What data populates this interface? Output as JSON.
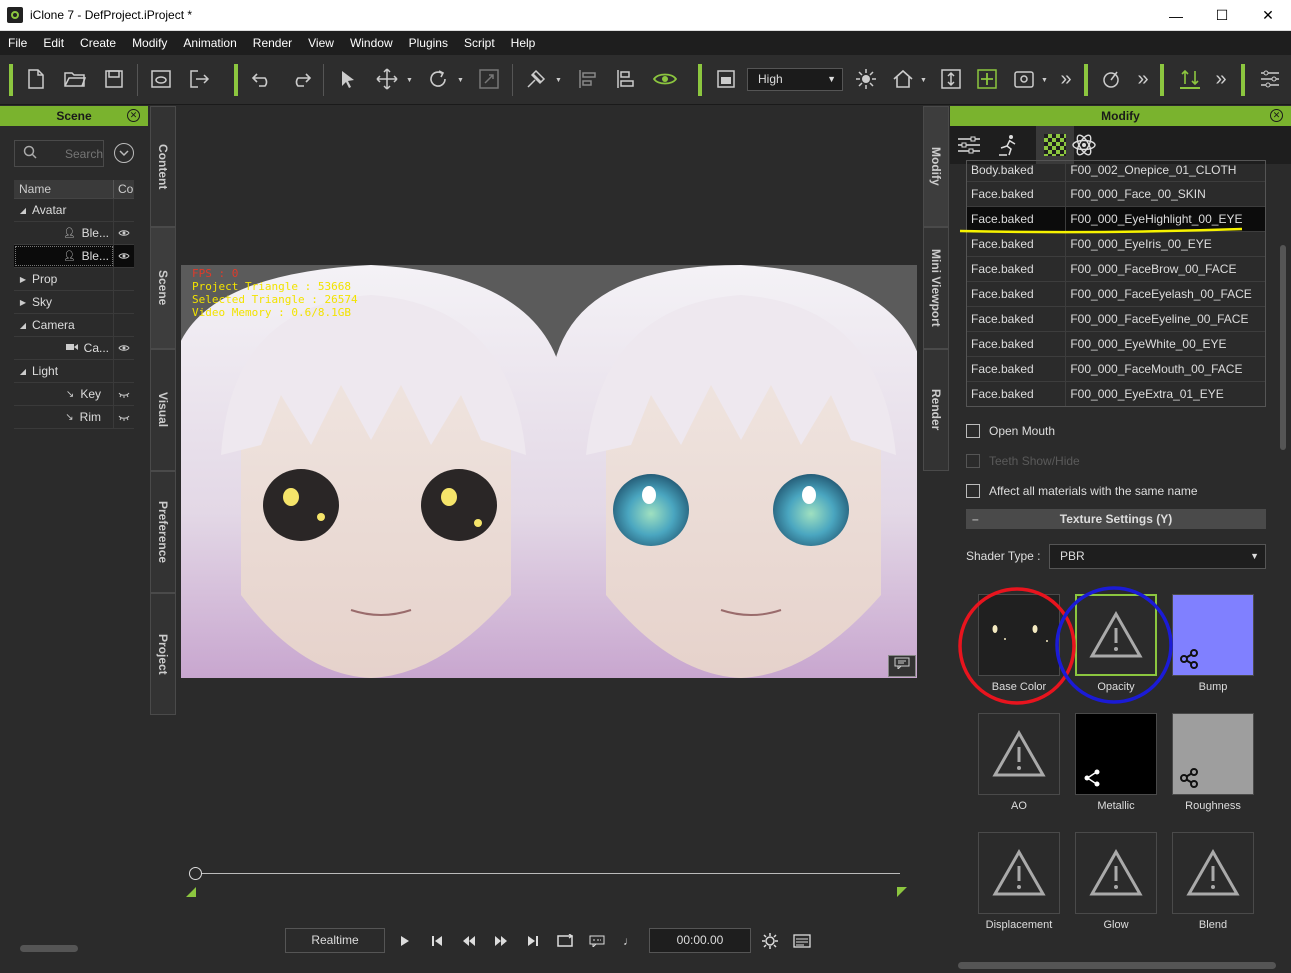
{
  "window": {
    "title": "iClone 7 - DefProject.iProject *",
    "controls": [
      "—",
      "☐",
      "✕"
    ]
  },
  "menu": [
    "File",
    "Edit",
    "Create",
    "Modify",
    "Animation",
    "Render",
    "View",
    "Window",
    "Plugins",
    "Script",
    "Help"
  ],
  "toolbar": {
    "quality_value": "High",
    "overflow_glyph": "»"
  },
  "scene_panel": {
    "title": "Scene",
    "search_placeholder": "Search",
    "columns": [
      "Name",
      "Co"
    ],
    "rows": [
      {
        "label": "Avatar",
        "type": "group",
        "expanded": true
      },
      {
        "label": "Ble...",
        "type": "child",
        "icon": "person-icon",
        "visibility": "eye-icon"
      },
      {
        "label": "Ble...",
        "type": "child",
        "icon": "person-icon",
        "visibility": "eye-icon",
        "selected": true
      },
      {
        "label": "Prop",
        "type": "group",
        "expanded": false
      },
      {
        "label": "Sky",
        "type": "group",
        "expanded": false
      },
      {
        "label": "Camera",
        "type": "group",
        "expanded": true
      },
      {
        "label": "Ca...",
        "type": "child",
        "icon": "camera-icon",
        "visibility": "eye-icon"
      },
      {
        "label": "Light",
        "type": "group",
        "expanded": true
      },
      {
        "label": "Key",
        "type": "child",
        "icon": "light-icon",
        "visibility": "eye-closed-icon"
      },
      {
        "label": "Rim",
        "type": "child",
        "icon": "light-icon",
        "visibility": "eye-closed-icon"
      }
    ]
  },
  "left_tabs": [
    "Content",
    "Scene",
    "Visual",
    "Preference",
    "Project"
  ],
  "right_tabs": [
    "Modify",
    "Mini Viewport",
    "Render"
  ],
  "viewport": {
    "stats": {
      "fps": "FPS : 0",
      "project_triangle": "Project Triangle : 53668",
      "selected_triangle": "Selected Triangle : 26574",
      "video_memory": "Video Memory : 0.6/8.1GB"
    }
  },
  "playback": {
    "mode": "Realtime",
    "timecode": "00:00.00"
  },
  "modify_panel": {
    "title": "Modify",
    "materials": [
      {
        "object": "Body.baked",
        "material": "F00_002_Onepice_01_CLOTH"
      },
      {
        "object": "Face.baked",
        "material": "F00_000_Face_00_SKIN"
      },
      {
        "object": "Face.baked",
        "material": "F00_000_EyeHighlight_00_EYE",
        "selected": true
      },
      {
        "object": "Face.baked",
        "material": "F00_000_EyeIris_00_EYE"
      },
      {
        "object": "Face.baked",
        "material": "F00_000_FaceBrow_00_FACE"
      },
      {
        "object": "Face.baked",
        "material": "F00_000_FaceEyelash_00_FACE"
      },
      {
        "object": "Face.baked",
        "material": "F00_000_FaceEyeline_00_FACE"
      },
      {
        "object": "Face.baked",
        "material": "F00_000_EyeWhite_00_EYE"
      },
      {
        "object": "Face.baked",
        "material": "F00_000_FaceMouth_00_FACE"
      },
      {
        "object": "Face.baked",
        "material": "F00_000_EyeExtra_01_EYE"
      }
    ],
    "open_mouth": "Open Mouth",
    "teeth": "Teeth Show/Hide",
    "affect_all": "Affect all materials with the same name",
    "texture_section": "Texture Settings  (Y)",
    "shader_label": "Shader Type :",
    "shader_value": "PBR",
    "textures": [
      {
        "label": "Base Color",
        "kind": "image-dark"
      },
      {
        "label": "Opacity",
        "kind": "warning-selected"
      },
      {
        "label": "Bump",
        "kind": "blue"
      },
      {
        "label": "AO",
        "kind": "warning"
      },
      {
        "label": "Metallic",
        "kind": "black"
      },
      {
        "label": "Roughness",
        "kind": "gray"
      },
      {
        "label": "Displacement",
        "kind": "warning"
      },
      {
        "label": "Glow",
        "kind": "warning"
      },
      {
        "label": "Blend",
        "kind": "warning"
      }
    ]
  },
  "colors": {
    "accent": "#8cc63f",
    "annotation_yellow": "#f7f300",
    "annotation_red": "#e8141e",
    "annotation_blue": "#1b1bd6",
    "bump_blue": "#8080ff"
  }
}
